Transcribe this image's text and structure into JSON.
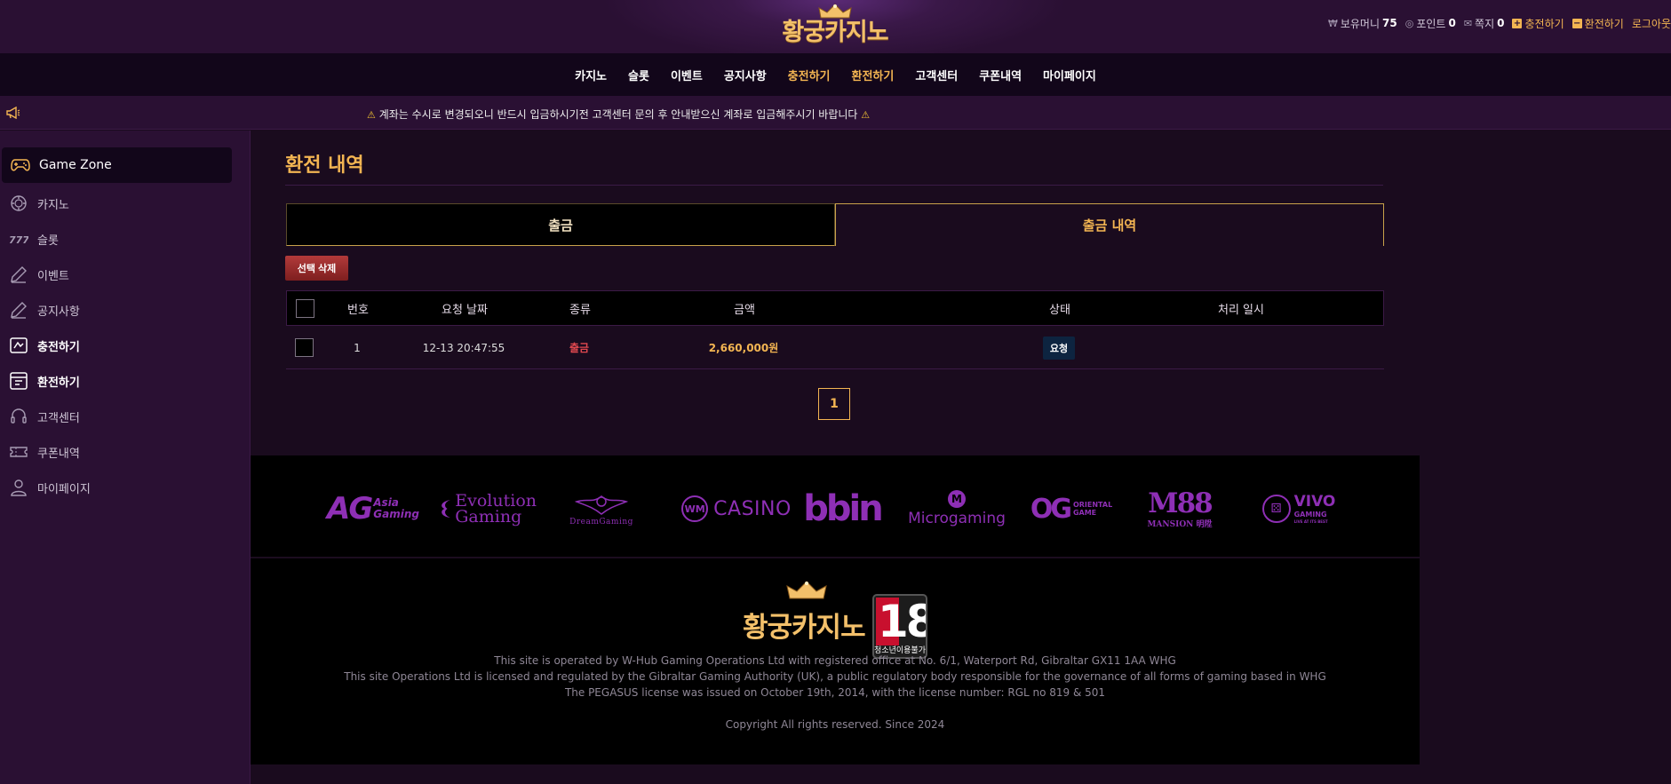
{
  "header": {
    "logo_text": "황궁카지노",
    "user_bar": {
      "money_label": "보유머니",
      "money_value": "75",
      "point_label": "포인트",
      "point_value": "0",
      "message_label": "쪽지",
      "message_value": "0",
      "charge_label": "충전하기",
      "exchange_label": "환전하기",
      "logout_label": "로그아웃"
    }
  },
  "nav": {
    "items": [
      "카지노",
      "슬롯",
      "이벤트",
      "공지사항",
      "충전하기",
      "환전하기",
      "고객센터",
      "쿠폰내역",
      "마이페이지"
    ]
  },
  "notice": {
    "text": "계좌는 수시로 변경되오니 반드시 입금하시기전 고객센터 문의 후 안내받으신 계좌로 입금해주시기 바랍니다"
  },
  "sidebar": {
    "header": "Game Zone",
    "items": [
      {
        "label": "카지노",
        "icon": "casino-chip-icon"
      },
      {
        "label": "슬롯",
        "icon": "slot-777-icon"
      },
      {
        "label": "이벤트",
        "icon": "pencil-icon"
      },
      {
        "label": "공지사항",
        "icon": "pencil-icon"
      },
      {
        "label": "충전하기",
        "icon": "deposit-icon"
      },
      {
        "label": "환전하기",
        "icon": "withdraw-icon"
      },
      {
        "label": "고객센터",
        "icon": "headset-icon"
      },
      {
        "label": "쿠폰내역",
        "icon": "ticket-icon"
      },
      {
        "label": "마이페이지",
        "icon": "user-icon"
      }
    ]
  },
  "main": {
    "title": "환전 내역",
    "tabs": [
      "출금",
      "출금 내역"
    ],
    "delete_button": "선택 삭제",
    "table": {
      "headers": [
        "번호",
        "요청 날짜",
        "종류",
        "금액",
        "상태",
        "처리 일시"
      ],
      "rows": [
        {
          "no": "1",
          "date": "12-13 20:47:55",
          "type": "출금",
          "amount": "2,660,000원",
          "status": "요청",
          "processed": ""
        }
      ]
    },
    "pagination": {
      "current": "1"
    }
  },
  "providers": [
    "Asia Gaming",
    "Evolution Gaming",
    "DreamGaming",
    "WM Casino",
    "bbin",
    "Microgaming",
    "Oriental Game",
    "M88 Mansion",
    "Vivo Gaming"
  ],
  "provider_logos": {
    "ag": "AG",
    "ag_sub1": "Asia",
    "ag_sub2": "Gaming",
    "evo1": "Evolution",
    "evo2": "Gaming",
    "dream": "DreamGaming",
    "wm_mark": "WM",
    "wm_text": "CASINO",
    "bbin": "bbin",
    "micro_mark": "M",
    "micro_text": "Microgaming",
    "og_mark": "OG",
    "og_text1": "ORIENTAL",
    "og_text2": "GAME",
    "m88": "M88",
    "m88_sub": "MANSION 明陞",
    "vivo_text": "VIVO",
    "vivo_sub": "GAMING",
    "vivo_tag": "LIVE AT ITS BEST"
  },
  "footer": {
    "logo_text": "황궁카지노",
    "age_badge_number": "18",
    "age_badge_label": "청소년이용불가",
    "legal": [
      "This site is operated by W-Hub Gaming Operations Ltd with registered office at No. 6/1, Waterport Rd, Gibraltar GX11 1AA WHG",
      "This site Operations Ltd is licensed and regulated by the Gibraltar Gaming Authority (UK), a public regulatory body responsible for the governance of all forms of gaming based in WHG",
      "The PEGASUS license was issued on October 19th, 2014, with the license number: RGL no 819 & 501"
    ],
    "copyright": "Copyright All rights reserved. Since 2024"
  },
  "colors": {
    "gold": "#f3b552",
    "purple_bg": "#2a1033",
    "dark_bg": "#1a0b1e",
    "red_type": "#e0484f",
    "provider_purple": "#8e2fb5"
  }
}
